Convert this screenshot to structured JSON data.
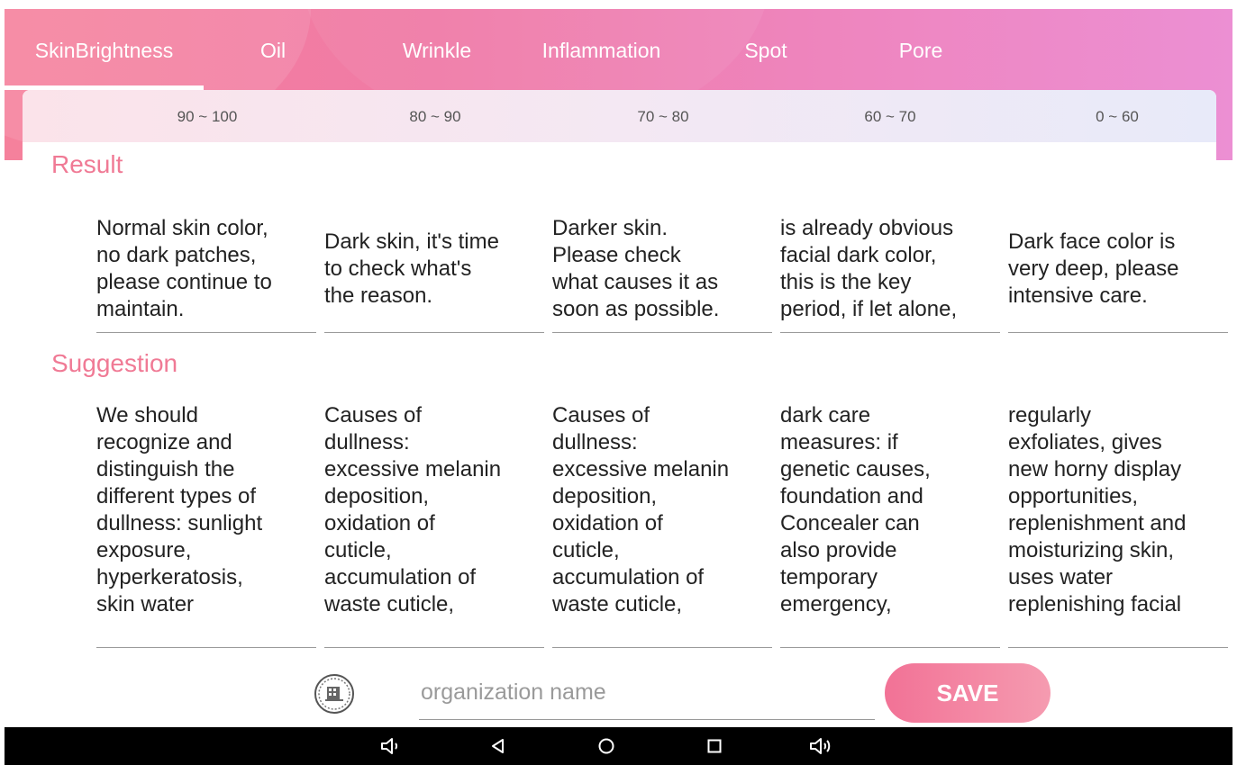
{
  "tabs": [
    "SkinBrightness",
    "Oil",
    "Wrinkle",
    "Inflammation",
    "Spot",
    "Pore"
  ],
  "ranges": [
    "90 ~ 100",
    "80 ~ 90",
    "70 ~ 80",
    "60 ~ 70",
    "0 ~ 60"
  ],
  "result": {
    "title": "Result",
    "cells": [
      "Normal skin color,\nno dark patches,\nplease continue to\nmaintain.",
      "Dark skin, it's time\nto check what's\nthe reason.",
      "Darker skin.\nPlease check\nwhat causes it as\nsoon as possible.",
      "is already obvious\nfacial dark color,\nthis is the key\nperiod, if let alone,",
      "Dark face color is\nvery deep, please\nintensive care."
    ]
  },
  "suggestion": {
    "title": "Suggestion",
    "cells": [
      "We should\nrecognize and\ndistinguish the\ndifferent types of\ndullness: sunlight\nexposure,\nhyperkeratosis,\nskin water",
      "Causes of\ndullness:\nexcessive melanin\ndeposition,\noxidation of\ncuticle,\naccumulation of\nwaste cuticle,",
      "Causes of\ndullness:\nexcessive melanin\ndeposition,\noxidation of\ncuticle,\naccumulation of\nwaste cuticle,",
      "dark care\nmeasures: if\ngenetic causes,\nfoundation and\nConcealer can\nalso provide\ntemporary\nemergency,",
      "regularly\nexfoliates, gives\nnew horny display\nopportunities,\nreplenishment and\nmoisturizing skin,\nuses water\nreplenishing facial"
    ]
  },
  "footer": {
    "org_placeholder": "organization name",
    "org_value": "",
    "save_label": "SAVE"
  },
  "colors": {
    "accent": "#f07a95",
    "header_start": "#f5819c",
    "header_end": "#ec8fd3"
  },
  "icons": {
    "org": "building-icon",
    "nav": [
      "volume-down-icon",
      "back-icon",
      "home-icon",
      "recents-icon",
      "volume-up-icon"
    ]
  }
}
